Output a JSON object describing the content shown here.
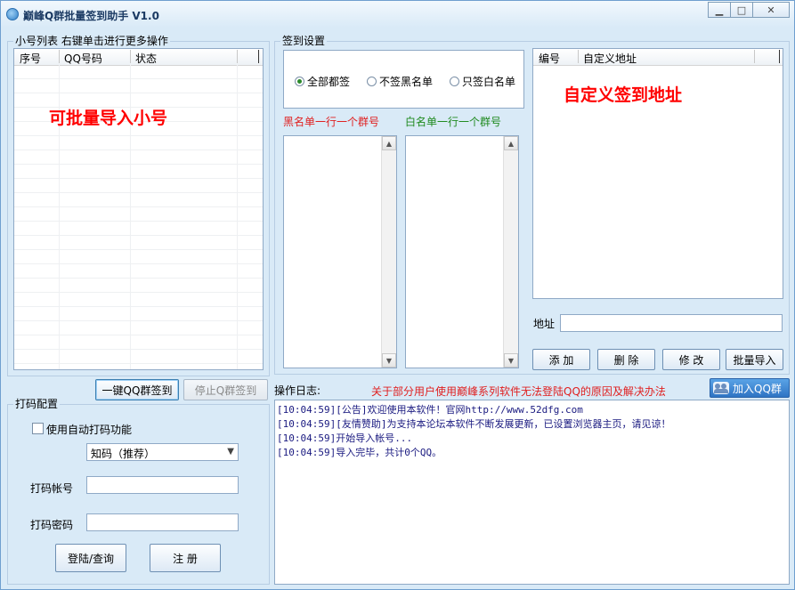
{
  "window": {
    "title": "巅峰Q群批量签到助手 V1.0",
    "min_glyph": "▁",
    "max_glyph": "□",
    "close_glyph": "✕"
  },
  "account_list": {
    "group_label": "小号列表  右键单击进行更多操作",
    "columns": [
      "序号",
      "QQ号码",
      "状态"
    ],
    "overlay_text": "可批量导入小号"
  },
  "signin_settings": {
    "group_label": "签到设置",
    "radios": [
      {
        "label": "全部都签",
        "checked": true
      },
      {
        "label": "不签黑名单",
        "checked": false
      },
      {
        "label": "只签白名单",
        "checked": false
      }
    ],
    "blacklist_label": "黑名单一行一个群号",
    "whitelist_label": "白名单一行一个群号",
    "blacklist_color": "#e02020",
    "whitelist_color": "#1f8a1f"
  },
  "custom_urls": {
    "columns": [
      "编号",
      "自定义地址"
    ],
    "overlay_text": "自定义签到地址",
    "address_label": "地址",
    "address_value": "",
    "buttons": {
      "add": "添 加",
      "delete": "删 除",
      "modify": "修 改",
      "batch_import": "批量导入"
    }
  },
  "actions": {
    "one_click": "一键QQ群签到",
    "stop": "停止Q群签到"
  },
  "captcha": {
    "group_label": "打码配置",
    "auto_label": "使用自动打码功能",
    "auto_checked": false,
    "service_selected": "知码（推荐）",
    "account_label": "打码帐号",
    "account_value": "",
    "password_label": "打码密码",
    "password_value": "",
    "login_button": "登陆/查询",
    "register_button": "注 册"
  },
  "log": {
    "label": "操作日志:",
    "notice": "关于部分用户使用巅峰系列软件无法登陆QQ的原因及解决办法",
    "notice_color": "#e02020",
    "qq_group_button": "加入QQ群",
    "entries": [
      "[10:04:59][公告]欢迎使用本软件！官网http://www.52dfg.com",
      "[10:04:59][友情赞助]为支持本论坛本软件不断发展更新，已设置浏览器主页，请见谅！",
      "[10:04:59]开始导入帐号...",
      "[10:04:59]导入完毕，共计0个QQ。"
    ]
  }
}
